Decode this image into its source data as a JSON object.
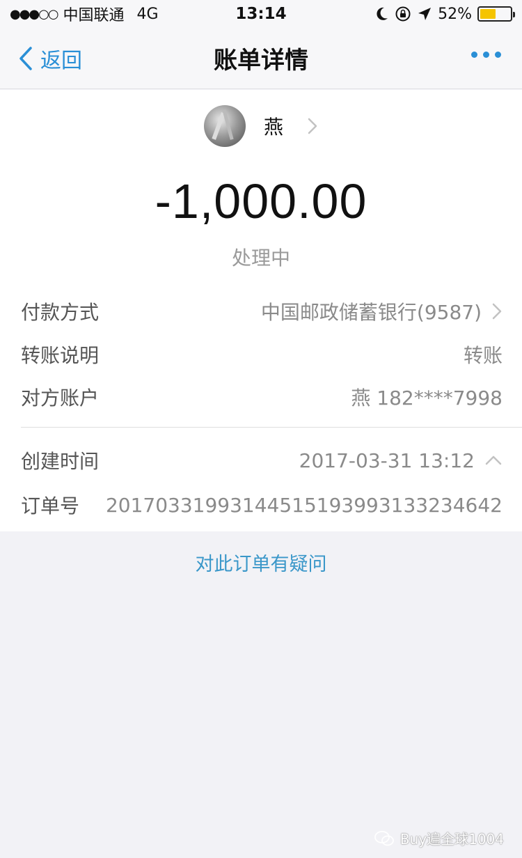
{
  "status_bar": {
    "signal": "●●●○○",
    "carrier": "中国联通",
    "network": "4G",
    "time": "13:14",
    "battery": "52%",
    "battery_color": "#f5c400"
  },
  "nav": {
    "back_label": "返回",
    "title": "账单详情"
  },
  "payee": {
    "name": "燕"
  },
  "amount": "-1,000.00",
  "status": "处理中",
  "details": {
    "payment_method_label": "付款方式",
    "payment_method_value": "中国邮政储蓄银行(9587)",
    "transfer_note_label": "转账说明",
    "transfer_note_value": "转账",
    "counterparty_label": "对方账户",
    "counterparty_value": "燕 182****7998",
    "created_time_label": "创建时间",
    "created_time_value": "2017-03-31 13:12",
    "order_no_label": "订单号",
    "order_no_value": "20170331993144515193993133234642"
  },
  "question_link": "对此订单有疑问",
  "watermark": "Buy遍全球1004",
  "colors": {
    "accent": "#2a8fd6",
    "link": "#3a97c9"
  }
}
